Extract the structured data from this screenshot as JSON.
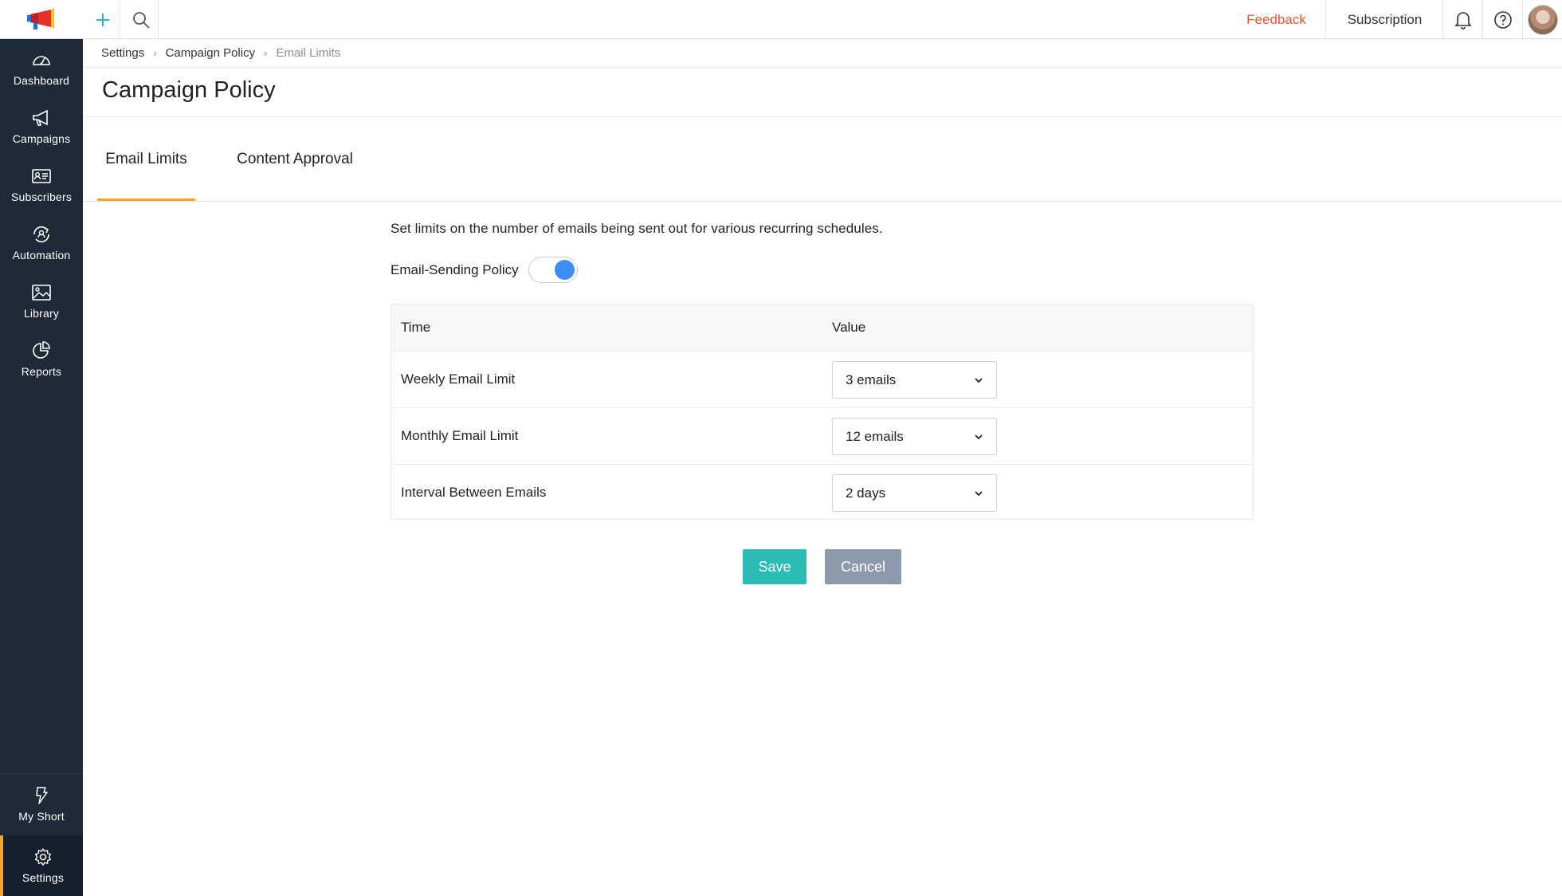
{
  "topbar": {
    "feedback": "Feedback",
    "subscription": "Subscription",
    "icons": [
      "megaphone-logo-icon",
      "plus-icon",
      "search-icon",
      "bell-icon",
      "help-icon",
      "avatar"
    ]
  },
  "sidebar": {
    "items": [
      {
        "label": "Dashboard",
        "icon": "dashboard-icon"
      },
      {
        "label": "Campaigns",
        "icon": "megaphone-icon"
      },
      {
        "label": "Subscribers",
        "icon": "contact-card-icon"
      },
      {
        "label": "Automation",
        "icon": "automation-icon"
      },
      {
        "label": "Library",
        "icon": "image-icon"
      },
      {
        "label": "Reports",
        "icon": "pie-chart-icon"
      }
    ],
    "bottom": [
      {
        "label": "My Short",
        "icon": "shortcut-icon"
      },
      {
        "label": "Settings",
        "icon": "gear-icon",
        "active": true
      }
    ]
  },
  "breadcrumb": {
    "items": [
      "Settings",
      "Campaign Policy",
      "Email Limits"
    ]
  },
  "page": {
    "title": "Campaign Policy",
    "tabs": [
      {
        "label": "Email Limits",
        "active": true
      },
      {
        "label": "Content Approval",
        "active": false
      }
    ],
    "description": "Set limits on the number of emails being sent out for various recurring schedules.",
    "policy_label": "Email-Sending Policy",
    "policy_enabled": true
  },
  "table": {
    "headers": [
      "Time",
      "Value"
    ],
    "rows": [
      {
        "label": "Weekly Email Limit",
        "value": "3 emails"
      },
      {
        "label": "Monthly Email Limit",
        "value": "12 emails"
      },
      {
        "label": "Interval Between Emails",
        "value": "2 days"
      }
    ]
  },
  "actions": {
    "save": "Save",
    "cancel": "Cancel"
  },
  "colors": {
    "accent_orange": "#f5a623",
    "feedback_red": "#e8552c",
    "save_teal": "#2bbcb6",
    "cancel_gray": "#8d9aab",
    "toggle_blue": "#3a8ff0",
    "sidebar_bg": "#1f2a38"
  }
}
